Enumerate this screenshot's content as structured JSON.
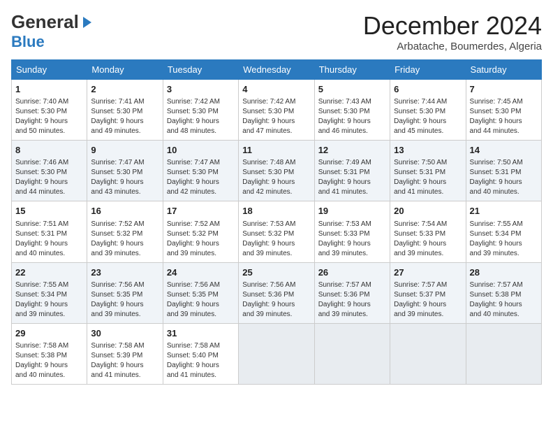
{
  "header": {
    "logo_general": "General",
    "logo_blue": "Blue",
    "month_title": "December 2024",
    "location": "Arbatache, Boumerdes, Algeria"
  },
  "columns": [
    "Sunday",
    "Monday",
    "Tuesday",
    "Wednesday",
    "Thursday",
    "Friday",
    "Saturday"
  ],
  "weeks": [
    [
      {
        "day": "1",
        "info": "Sunrise: 7:40 AM\nSunset: 5:30 PM\nDaylight: 9 hours\nand 50 minutes."
      },
      {
        "day": "2",
        "info": "Sunrise: 7:41 AM\nSunset: 5:30 PM\nDaylight: 9 hours\nand 49 minutes."
      },
      {
        "day": "3",
        "info": "Sunrise: 7:42 AM\nSunset: 5:30 PM\nDaylight: 9 hours\nand 48 minutes."
      },
      {
        "day": "4",
        "info": "Sunrise: 7:42 AM\nSunset: 5:30 PM\nDaylight: 9 hours\nand 47 minutes."
      },
      {
        "day": "5",
        "info": "Sunrise: 7:43 AM\nSunset: 5:30 PM\nDaylight: 9 hours\nand 46 minutes."
      },
      {
        "day": "6",
        "info": "Sunrise: 7:44 AM\nSunset: 5:30 PM\nDaylight: 9 hours\nand 45 minutes."
      },
      {
        "day": "7",
        "info": "Sunrise: 7:45 AM\nSunset: 5:30 PM\nDaylight: 9 hours\nand 44 minutes."
      }
    ],
    [
      {
        "day": "8",
        "info": "Sunrise: 7:46 AM\nSunset: 5:30 PM\nDaylight: 9 hours\nand 44 minutes."
      },
      {
        "day": "9",
        "info": "Sunrise: 7:47 AM\nSunset: 5:30 PM\nDaylight: 9 hours\nand 43 minutes."
      },
      {
        "day": "10",
        "info": "Sunrise: 7:47 AM\nSunset: 5:30 PM\nDaylight: 9 hours\nand 42 minutes."
      },
      {
        "day": "11",
        "info": "Sunrise: 7:48 AM\nSunset: 5:30 PM\nDaylight: 9 hours\nand 42 minutes."
      },
      {
        "day": "12",
        "info": "Sunrise: 7:49 AM\nSunset: 5:31 PM\nDaylight: 9 hours\nand 41 minutes."
      },
      {
        "day": "13",
        "info": "Sunrise: 7:50 AM\nSunset: 5:31 PM\nDaylight: 9 hours\nand 41 minutes."
      },
      {
        "day": "14",
        "info": "Sunrise: 7:50 AM\nSunset: 5:31 PM\nDaylight: 9 hours\nand 40 minutes."
      }
    ],
    [
      {
        "day": "15",
        "info": "Sunrise: 7:51 AM\nSunset: 5:31 PM\nDaylight: 9 hours\nand 40 minutes."
      },
      {
        "day": "16",
        "info": "Sunrise: 7:52 AM\nSunset: 5:32 PM\nDaylight: 9 hours\nand 39 minutes."
      },
      {
        "day": "17",
        "info": "Sunrise: 7:52 AM\nSunset: 5:32 PM\nDaylight: 9 hours\nand 39 minutes."
      },
      {
        "day": "18",
        "info": "Sunrise: 7:53 AM\nSunset: 5:32 PM\nDaylight: 9 hours\nand 39 minutes."
      },
      {
        "day": "19",
        "info": "Sunrise: 7:53 AM\nSunset: 5:33 PM\nDaylight: 9 hours\nand 39 minutes."
      },
      {
        "day": "20",
        "info": "Sunrise: 7:54 AM\nSunset: 5:33 PM\nDaylight: 9 hours\nand 39 minutes."
      },
      {
        "day": "21",
        "info": "Sunrise: 7:55 AM\nSunset: 5:34 PM\nDaylight: 9 hours\nand 39 minutes."
      }
    ],
    [
      {
        "day": "22",
        "info": "Sunrise: 7:55 AM\nSunset: 5:34 PM\nDaylight: 9 hours\nand 39 minutes."
      },
      {
        "day": "23",
        "info": "Sunrise: 7:56 AM\nSunset: 5:35 PM\nDaylight: 9 hours\nand 39 minutes."
      },
      {
        "day": "24",
        "info": "Sunrise: 7:56 AM\nSunset: 5:35 PM\nDaylight: 9 hours\nand 39 minutes."
      },
      {
        "day": "25",
        "info": "Sunrise: 7:56 AM\nSunset: 5:36 PM\nDaylight: 9 hours\nand 39 minutes."
      },
      {
        "day": "26",
        "info": "Sunrise: 7:57 AM\nSunset: 5:36 PM\nDaylight: 9 hours\nand 39 minutes."
      },
      {
        "day": "27",
        "info": "Sunrise: 7:57 AM\nSunset: 5:37 PM\nDaylight: 9 hours\nand 39 minutes."
      },
      {
        "day": "28",
        "info": "Sunrise: 7:57 AM\nSunset: 5:38 PM\nDaylight: 9 hours\nand 40 minutes."
      }
    ],
    [
      {
        "day": "29",
        "info": "Sunrise: 7:58 AM\nSunset: 5:38 PM\nDaylight: 9 hours\nand 40 minutes."
      },
      {
        "day": "30",
        "info": "Sunrise: 7:58 AM\nSunset: 5:39 PM\nDaylight: 9 hours\nand 41 minutes."
      },
      {
        "day": "31",
        "info": "Sunrise: 7:58 AM\nSunset: 5:40 PM\nDaylight: 9 hours\nand 41 minutes."
      },
      {
        "day": "",
        "info": ""
      },
      {
        "day": "",
        "info": ""
      },
      {
        "day": "",
        "info": ""
      },
      {
        "day": "",
        "info": ""
      }
    ]
  ]
}
